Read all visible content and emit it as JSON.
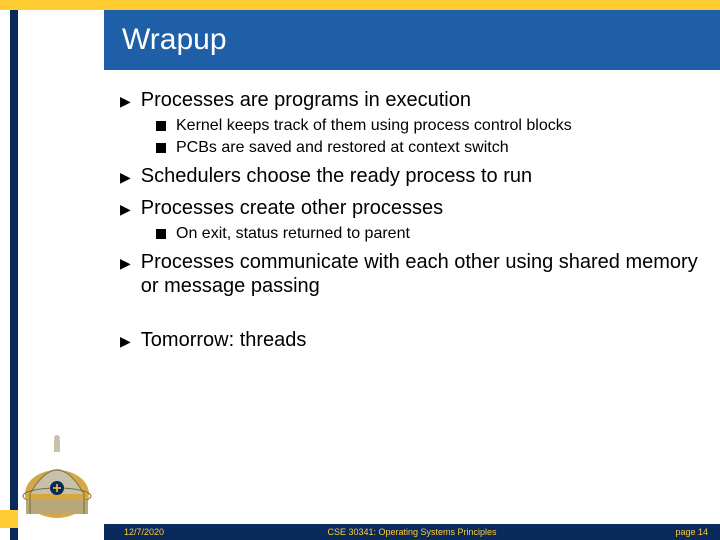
{
  "title": "Wrapup",
  "bullets": [
    {
      "level": 1,
      "text": "Processes are programs in execution"
    },
    {
      "level": 2,
      "text": "Kernel keeps track of them using process control blocks"
    },
    {
      "level": 2,
      "text": "PCBs are saved and restored at context switch"
    },
    {
      "level": 1,
      "text": "Schedulers choose the ready process to run"
    },
    {
      "level": 1,
      "text": "Processes create other processes"
    },
    {
      "level": 2,
      "text": "On exit, status returned to parent"
    },
    {
      "level": 1,
      "text": "Processes communicate with each other using shared memory or message passing"
    },
    {
      "level": 0,
      "text": ""
    },
    {
      "level": 1,
      "text": "Tomorrow: threads"
    }
  ],
  "footer": {
    "date": "12/7/2020",
    "course": "CSE 30341: Operating Systems Principles",
    "page": "page 14"
  }
}
